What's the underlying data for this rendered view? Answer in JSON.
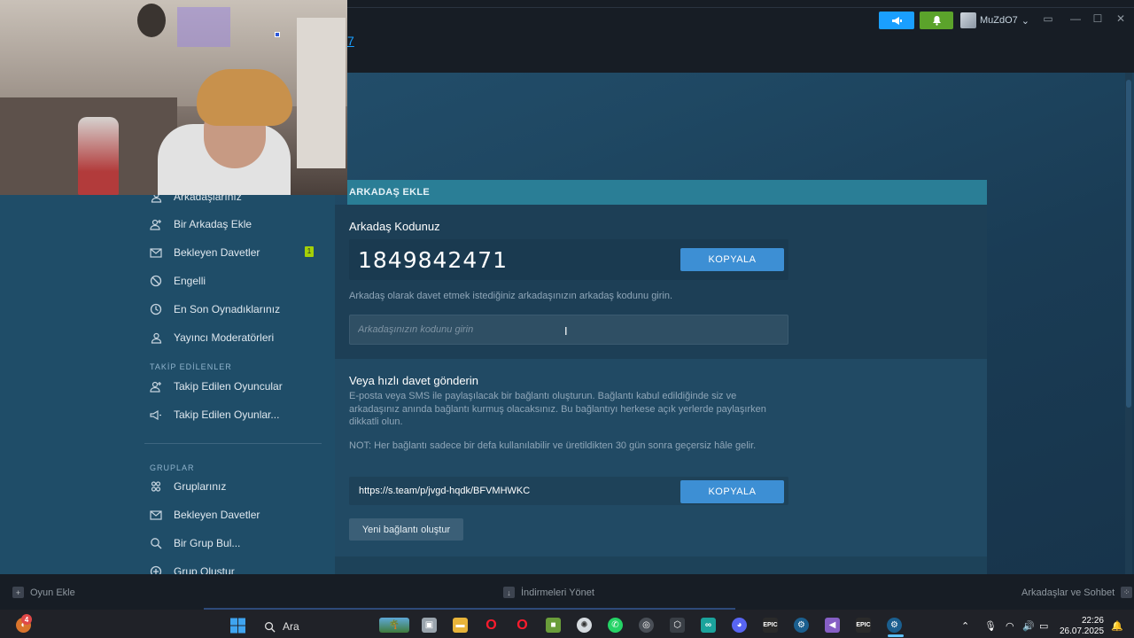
{
  "window": {
    "nav_fragment": "7",
    "username": "MuZdO7",
    "user_caret": "⌄",
    "announce_icon": "megaphone-icon",
    "notify_icon": "bell-icon"
  },
  "sidebar": {
    "truncated_top": "Arkadaşlarınız",
    "items": [
      {
        "label": "Bir Arkadaş Ekle",
        "icon": "add-friend-icon"
      },
      {
        "label": "Bekleyen Davetler",
        "icon": "envelope-icon",
        "badge": "1"
      },
      {
        "label": "Engelli",
        "icon": "blocked-icon"
      },
      {
        "label": "En Son Oynadıklarınız",
        "icon": "clock-icon"
      },
      {
        "label": "Yayıncı Moderatörleri",
        "icon": "person-icon"
      }
    ],
    "following_header": "TAKİP EDİLENLER",
    "following": [
      {
        "label": "Takip Edilen Oyuncular",
        "icon": "add-friend-icon"
      },
      {
        "label": "Takip Edilen Oyunlar...",
        "icon": "megaphone-icon"
      }
    ],
    "groups_header": "GRUPLAR",
    "groups": [
      {
        "label": "Gruplarınız",
        "icon": "groups-icon"
      },
      {
        "label": "Bekleyen Davetler",
        "icon": "envelope-icon"
      },
      {
        "label": "Bir Grup Bul...",
        "icon": "search-icon"
      },
      {
        "label": "Grup Oluştur",
        "icon": "plus-circle-icon"
      }
    ]
  },
  "panel": {
    "header": "ARKADAŞ EKLE",
    "code_title": "Arkadaş Kodunuz",
    "friend_code": "1849842471",
    "copy_label": "KOPYALA",
    "hint": "Arkadaş olarak davet etmek istediğiniz arkadaşınızın arkadaş kodunu girin.",
    "input_placeholder": "Arkadaşınızın kodunu girin",
    "quick_title": "Veya hızlı davet gönderin",
    "quick_desc": "E-posta veya SMS ile paylaşılacak bir bağlantı oluşturun. Bağlantı kabul edildiğinde siz ve arkadaşınız anında bağlantı kurmuş olacaksınız. Bu bağlantıyı herkese açık yerlerde paylaşırken dikkatli olun.",
    "note": "NOT: Her bağlantı sadece bir defa kullanılabilir ve üretildikten 30 gün sonra geçersiz hâle gelir.",
    "invite_link": "https://s.team/p/jvgd-hqdk/BFVMHWKC",
    "copy_label_2": "KOPYALA",
    "new_link_label": "Yeni bağlantı oluştur"
  },
  "bottom_bar": {
    "add_game": "Oyun Ekle",
    "downloads": "İndirmeleri Yönet",
    "friends_chat": "Arkadaşlar ve Sohbet"
  },
  "taskbar": {
    "search_label": "Ara",
    "time": "22:26",
    "date": "26.07.2025",
    "notif_badge": "4"
  },
  "colors": {
    "accent_blue": "#1a9fff",
    "accent_green": "#5ba32b",
    "panel_header": "#2a7e96",
    "copy_button": "#3d8fd4"
  }
}
